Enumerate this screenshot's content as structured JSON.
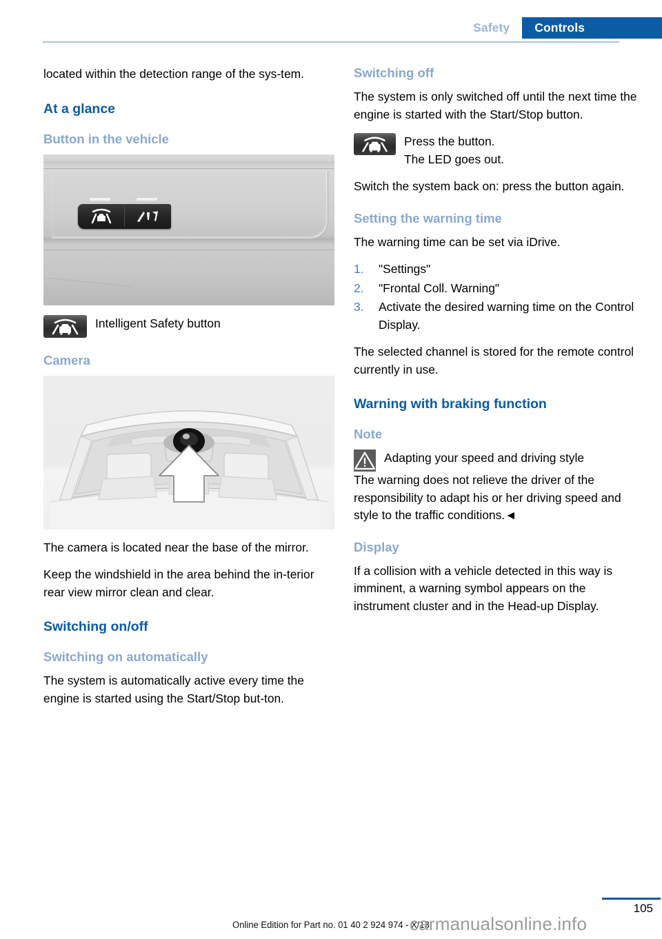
{
  "header": {
    "tab_inactive": "Safety",
    "tab_active": "Controls",
    "accent_color": "#0b5ba5",
    "muted_heading_color": "#8aa8cf"
  },
  "left_column": {
    "intro_paragraph": "located within the detection range of the sys‑tem.",
    "heading_at_a_glance": "At a glance",
    "heading_button_in_vehicle": "Button in the vehicle",
    "figure_button": {
      "name": "dashboard-intelligent-safety-buttons-photo",
      "caption_icon": "intelligent-safety-icon",
      "caption": "Intelligent Safety button"
    },
    "heading_camera": "Camera",
    "figure_camera": {
      "name": "windshield-camera-location-illustration"
    },
    "camera_paragraph_1": "The camera is located near the base of the mirror.",
    "camera_paragraph_2": "Keep the windshield in the area behind the in‑terior rear view mirror clean and clear.",
    "heading_switching_on_off": "Switching on/off",
    "heading_switching_on_automatically": "Switching on automatically",
    "switching_on_paragraph": "The system is automatically active every time the engine is started using the Start/Stop but‑ton."
  },
  "right_column": {
    "heading_switching_off": "Switching off",
    "switching_off_paragraph": "The system is only switched off until the next time the engine is started with the Start/Stop button.",
    "press_button_icon": "intelligent-safety-icon",
    "press_button_line_1": "Press the button.",
    "press_button_line_2": "The LED goes out.",
    "switch_back_on_paragraph": "Switch the system back on: press the button again.",
    "heading_setting_warning_time": "Setting the warning time",
    "warning_time_intro": "The warning time can be set via iDrive.",
    "steps": [
      "\"Settings\"",
      "\"Frontal Coll. Warning\"",
      "Activate the desired warning time on the Control Display."
    ],
    "selected_channel_paragraph": "The selected channel is stored for the remote control currently in use.",
    "heading_warning_braking": "Warning with braking function",
    "heading_note": "Note",
    "note_icon": "warning-triangle-icon",
    "note_title": "Adapting your speed and driving style",
    "note_body": "The warning does not relieve the driver of the responsibility to adapt his or her driving speed and style to the traffic conditions.",
    "note_end_mark": "◄",
    "heading_display": "Display",
    "display_paragraph": "If a collision with a vehicle detected in this way is imminent, a warning symbol appears on the instrument cluster and in the Head-up Display."
  },
  "footer": {
    "page_number": "105",
    "edition_text": "Online Edition for Part no. 01 40 2 924 974 - X/13",
    "watermark": "carmanualsonline.info"
  }
}
